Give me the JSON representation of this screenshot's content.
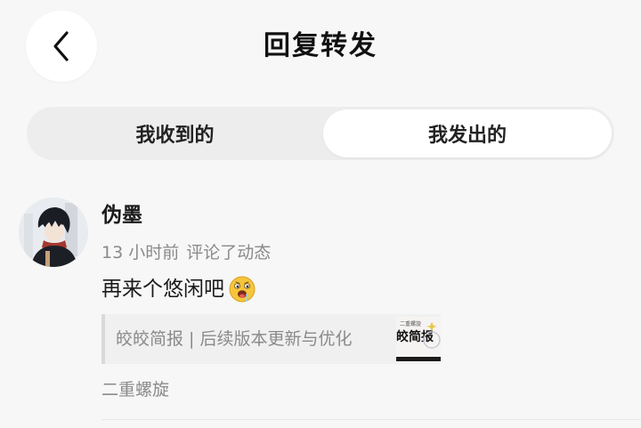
{
  "header": {
    "back_icon": "chevron-left-icon",
    "title": "回复转发"
  },
  "tabs": [
    {
      "label": "我收到的",
      "selected": false
    },
    {
      "label": "我发出的",
      "selected": true
    }
  ],
  "item": {
    "username": "伪墨",
    "time": "13 小时前",
    "action": "评论了动态",
    "content": "再来个悠闲吧",
    "emoji_icon": "drooling-face-emoji-icon",
    "quote": {
      "text": "皎皎简报 | 后续版本更新与优化",
      "thumb_label": "皎简报",
      "thumb_small": "二重螺旋"
    },
    "source": "二重螺旋"
  },
  "colors": {
    "background": "#f7f7f7",
    "tab_track": "#ededed",
    "tab_selected": "#ffffff",
    "muted_text": "#8a8a8a",
    "quote_bg": "#f0f0f0"
  }
}
